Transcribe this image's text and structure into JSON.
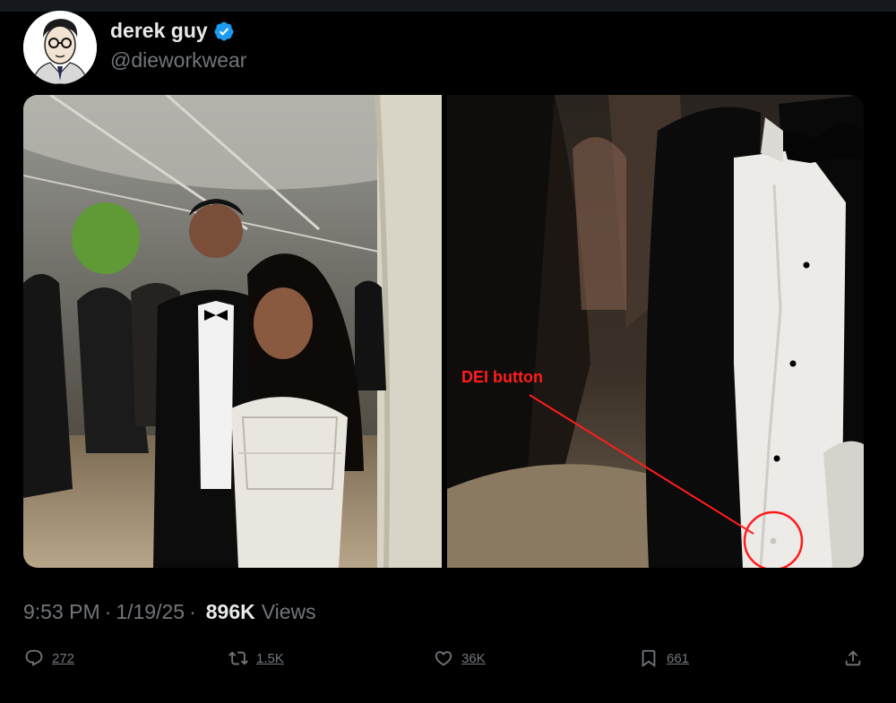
{
  "author": {
    "display_name": "derek guy",
    "handle": "@dieworkwear",
    "avatar_icon": "caricature-avatar",
    "verified_icon": "verified-badge-icon",
    "verified_color": "#1d9bf0"
  },
  "media": {
    "annotation_label": "DEI button",
    "annotation_color": "#ff1d1d"
  },
  "meta": {
    "time": "9:53 PM",
    "date": "1/19/25",
    "separator": "·",
    "views_count": "896K",
    "views_label": "Views"
  },
  "actions": {
    "reply_count": "272",
    "repost_count": "1.5K",
    "like_count": "36K",
    "bookmark_count": "661",
    "icons": [
      "reply-icon",
      "repost-icon",
      "like-icon",
      "bookmark-icon",
      "share-icon"
    ]
  },
  "colors": {
    "background": "#000000",
    "text_primary": "#e7e9ea",
    "text_secondary": "#71767b"
  }
}
